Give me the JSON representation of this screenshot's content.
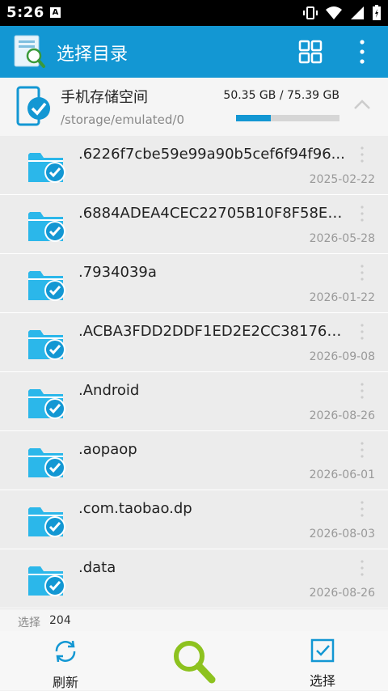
{
  "status": {
    "time": "5:26",
    "notif_icon": "A"
  },
  "header": {
    "title": "选择目录"
  },
  "storage": {
    "name": "手机存储空间",
    "path": "/storage/emulated/0",
    "size": "50.35 GB / 75.39 GB",
    "used_fraction": 0.335
  },
  "folders": [
    {
      "name": ".6226f7cbe59e99a90b5cef6f94f96...",
      "date": "2025-02-22"
    },
    {
      "name": ".6884ADEA4CEC22705B10F8F58E9...",
      "date": "2026-05-28"
    },
    {
      "name": ".7934039a",
      "date": "2026-01-22"
    },
    {
      "name": ".ACBA3FDD2DDF1ED2E2CC381769...",
      "date": "2026-09-08"
    },
    {
      "name": ".Android",
      "date": "2026-08-26"
    },
    {
      "name": ".aopaop",
      "date": "2026-06-01"
    },
    {
      "name": ".com.taobao.dp",
      "date": "2026-08-03"
    },
    {
      "name": ".data",
      "date": "2026-08-26"
    }
  ],
  "selection": {
    "label": "选择",
    "count": "204"
  },
  "bottom": {
    "refresh_label": "刷新",
    "select_label": "选择"
  },
  "colors": {
    "accent": "#1397d3",
    "folder": "#2bb7ea",
    "search": "#8dc21f"
  }
}
